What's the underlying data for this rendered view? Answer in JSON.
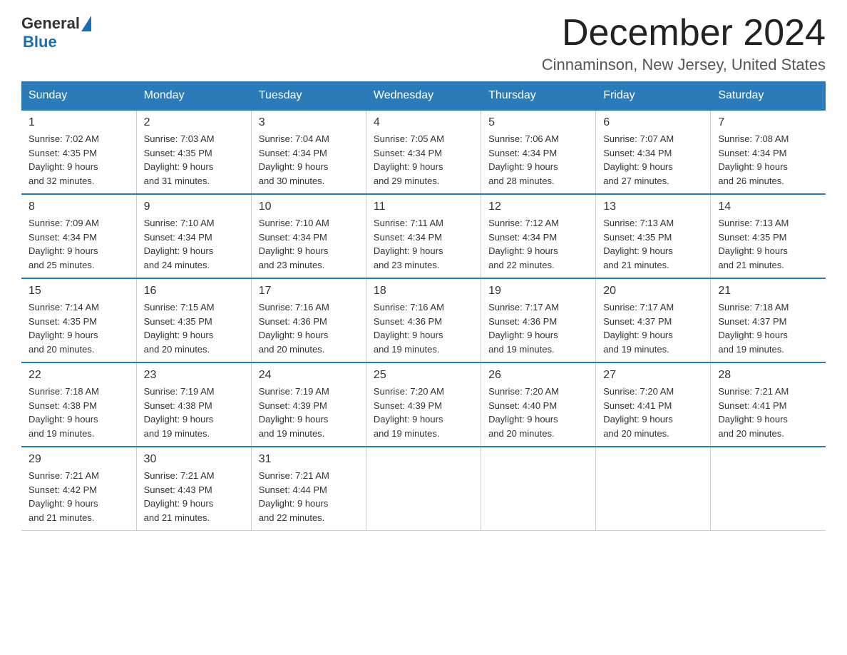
{
  "header": {
    "logo_general": "General",
    "logo_blue": "Blue",
    "month_title": "December 2024",
    "location": "Cinnaminson, New Jersey, United States"
  },
  "weekdays": [
    "Sunday",
    "Monday",
    "Tuesday",
    "Wednesday",
    "Thursday",
    "Friday",
    "Saturday"
  ],
  "weeks": [
    [
      {
        "day": "1",
        "sunrise": "7:02 AM",
        "sunset": "4:35 PM",
        "daylight": "9 hours and 32 minutes."
      },
      {
        "day": "2",
        "sunrise": "7:03 AM",
        "sunset": "4:35 PM",
        "daylight": "9 hours and 31 minutes."
      },
      {
        "day": "3",
        "sunrise": "7:04 AM",
        "sunset": "4:34 PM",
        "daylight": "9 hours and 30 minutes."
      },
      {
        "day": "4",
        "sunrise": "7:05 AM",
        "sunset": "4:34 PM",
        "daylight": "9 hours and 29 minutes."
      },
      {
        "day": "5",
        "sunrise": "7:06 AM",
        "sunset": "4:34 PM",
        "daylight": "9 hours and 28 minutes."
      },
      {
        "day": "6",
        "sunrise": "7:07 AM",
        "sunset": "4:34 PM",
        "daylight": "9 hours and 27 minutes."
      },
      {
        "day": "7",
        "sunrise": "7:08 AM",
        "sunset": "4:34 PM",
        "daylight": "9 hours and 26 minutes."
      }
    ],
    [
      {
        "day": "8",
        "sunrise": "7:09 AM",
        "sunset": "4:34 PM",
        "daylight": "9 hours and 25 minutes."
      },
      {
        "day": "9",
        "sunrise": "7:10 AM",
        "sunset": "4:34 PM",
        "daylight": "9 hours and 24 minutes."
      },
      {
        "day": "10",
        "sunrise": "7:10 AM",
        "sunset": "4:34 PM",
        "daylight": "9 hours and 23 minutes."
      },
      {
        "day": "11",
        "sunrise": "7:11 AM",
        "sunset": "4:34 PM",
        "daylight": "9 hours and 23 minutes."
      },
      {
        "day": "12",
        "sunrise": "7:12 AM",
        "sunset": "4:34 PM",
        "daylight": "9 hours and 22 minutes."
      },
      {
        "day": "13",
        "sunrise": "7:13 AM",
        "sunset": "4:35 PM",
        "daylight": "9 hours and 21 minutes."
      },
      {
        "day": "14",
        "sunrise": "7:13 AM",
        "sunset": "4:35 PM",
        "daylight": "9 hours and 21 minutes."
      }
    ],
    [
      {
        "day": "15",
        "sunrise": "7:14 AM",
        "sunset": "4:35 PM",
        "daylight": "9 hours and 20 minutes."
      },
      {
        "day": "16",
        "sunrise": "7:15 AM",
        "sunset": "4:35 PM",
        "daylight": "9 hours and 20 minutes."
      },
      {
        "day": "17",
        "sunrise": "7:16 AM",
        "sunset": "4:36 PM",
        "daylight": "9 hours and 20 minutes."
      },
      {
        "day": "18",
        "sunrise": "7:16 AM",
        "sunset": "4:36 PM",
        "daylight": "9 hours and 19 minutes."
      },
      {
        "day": "19",
        "sunrise": "7:17 AM",
        "sunset": "4:36 PM",
        "daylight": "9 hours and 19 minutes."
      },
      {
        "day": "20",
        "sunrise": "7:17 AM",
        "sunset": "4:37 PM",
        "daylight": "9 hours and 19 minutes."
      },
      {
        "day": "21",
        "sunrise": "7:18 AM",
        "sunset": "4:37 PM",
        "daylight": "9 hours and 19 minutes."
      }
    ],
    [
      {
        "day": "22",
        "sunrise": "7:18 AM",
        "sunset": "4:38 PM",
        "daylight": "9 hours and 19 minutes."
      },
      {
        "day": "23",
        "sunrise": "7:19 AM",
        "sunset": "4:38 PM",
        "daylight": "9 hours and 19 minutes."
      },
      {
        "day": "24",
        "sunrise": "7:19 AM",
        "sunset": "4:39 PM",
        "daylight": "9 hours and 19 minutes."
      },
      {
        "day": "25",
        "sunrise": "7:20 AM",
        "sunset": "4:39 PM",
        "daylight": "9 hours and 19 minutes."
      },
      {
        "day": "26",
        "sunrise": "7:20 AM",
        "sunset": "4:40 PM",
        "daylight": "9 hours and 20 minutes."
      },
      {
        "day": "27",
        "sunrise": "7:20 AM",
        "sunset": "4:41 PM",
        "daylight": "9 hours and 20 minutes."
      },
      {
        "day": "28",
        "sunrise": "7:21 AM",
        "sunset": "4:41 PM",
        "daylight": "9 hours and 20 minutes."
      }
    ],
    [
      {
        "day": "29",
        "sunrise": "7:21 AM",
        "sunset": "4:42 PM",
        "daylight": "9 hours and 21 minutes."
      },
      {
        "day": "30",
        "sunrise": "7:21 AM",
        "sunset": "4:43 PM",
        "daylight": "9 hours and 21 minutes."
      },
      {
        "day": "31",
        "sunrise": "7:21 AM",
        "sunset": "4:44 PM",
        "daylight": "9 hours and 22 minutes."
      },
      null,
      null,
      null,
      null
    ]
  ]
}
